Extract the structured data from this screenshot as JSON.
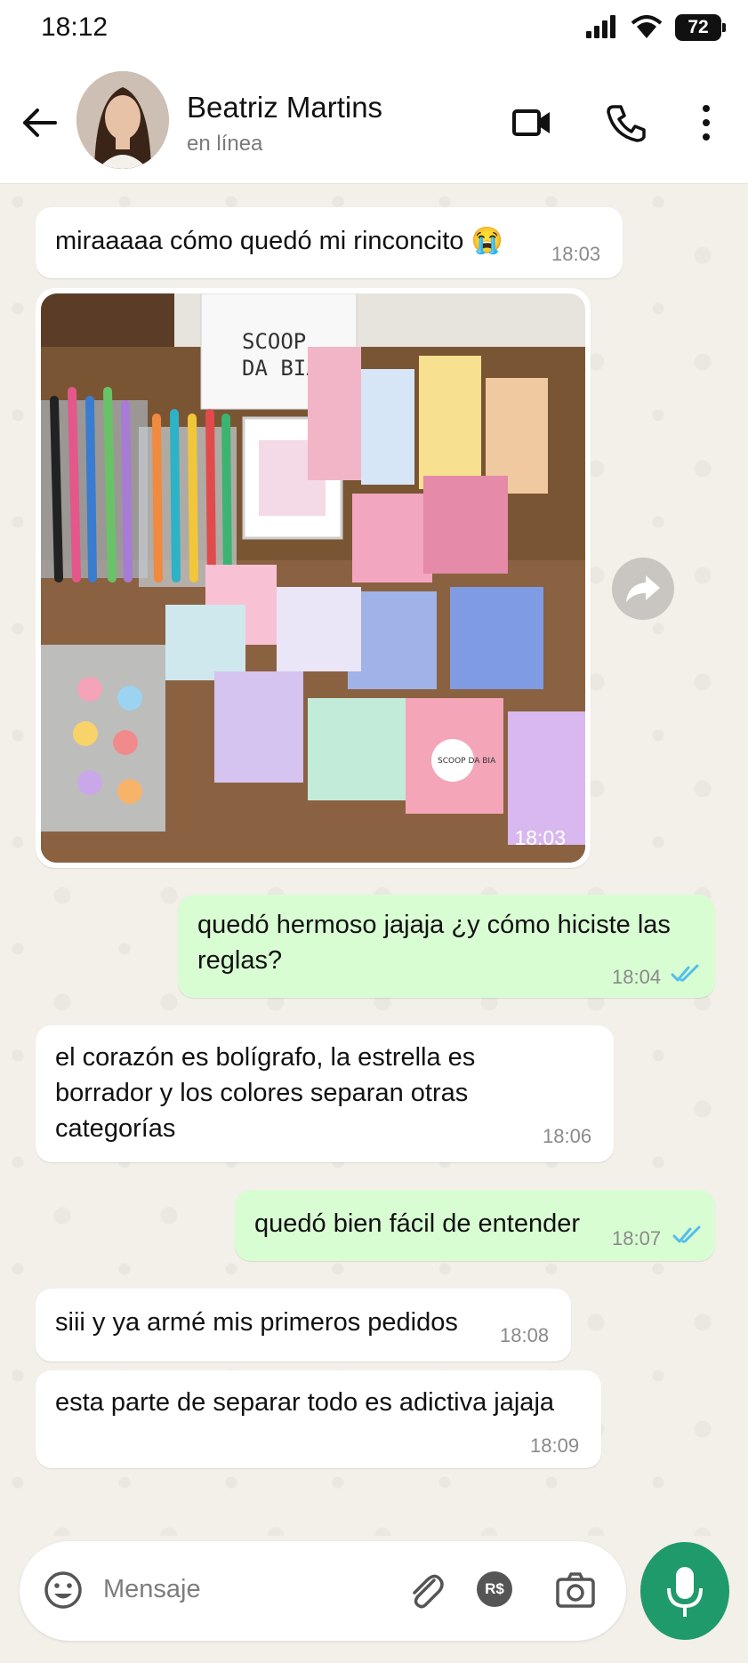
{
  "status_bar": {
    "time": "18:12",
    "battery": "72"
  },
  "header": {
    "contact_name": "Beatriz Martins",
    "contact_status": "en línea",
    "icons": [
      "back-arrow-icon",
      "video-call-icon",
      "phone-icon",
      "more-vert-icon"
    ]
  },
  "messages": [
    {
      "dir": "in",
      "text": "miraaaaa cómo quedó mi rinconcito 😭",
      "time": "18:03"
    },
    {
      "dir": "in",
      "type": "image",
      "time": "18:03",
      "image_text": {
        "box_line1": "SCOOP",
        "box_line2": "DA BIA",
        "sticker": "SCOOP DA BIA"
      }
    },
    {
      "dir": "out",
      "text_line1": "quedó hermoso jajaja ¿y cómo hiciste las",
      "text_line2": "reglas?",
      "time": "18:04",
      "status": "read"
    },
    {
      "dir": "in",
      "text_line1": "el corazón es bolígrafo, la estrella es",
      "text_line2": "borrador y los colores separan otras",
      "text_line3": "categorías",
      "time": "18:06"
    },
    {
      "dir": "out",
      "text": "quedó bien fácil de entender",
      "time": "18:07",
      "status": "read"
    },
    {
      "dir": "in",
      "text": "siii y ya armé mis primeros pedidos",
      "time": "18:08"
    },
    {
      "dir": "in",
      "text": "esta parte de separar todo es adictiva jajaja",
      "time": "18:09"
    }
  ],
  "composer": {
    "placeholder": "Mensaje",
    "icons": [
      "emoji-icon",
      "attach-icon",
      "payment-icon",
      "camera-icon",
      "mic-icon"
    ],
    "payment_label": "R$"
  },
  "colors": {
    "incoming": "#ffffff",
    "outgoing": "#d9fdd3",
    "accent": "#1f9a6b",
    "read_tick": "#53bdeb"
  }
}
